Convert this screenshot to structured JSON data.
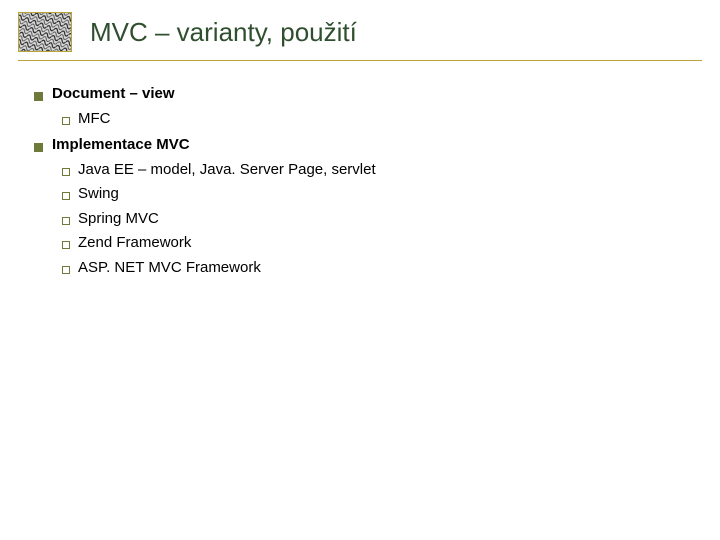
{
  "title": "MVC – varianty, použití",
  "sections": [
    {
      "heading": "Document – view",
      "items": [
        "MFC"
      ]
    },
    {
      "heading": "Implementace MVC",
      "items": [
        "Java EE – model, Java. Server Page, servlet",
        "Swing",
        "Spring MVC",
        "Zend Framework",
        "ASP. NET MVC Framework"
      ]
    }
  ]
}
